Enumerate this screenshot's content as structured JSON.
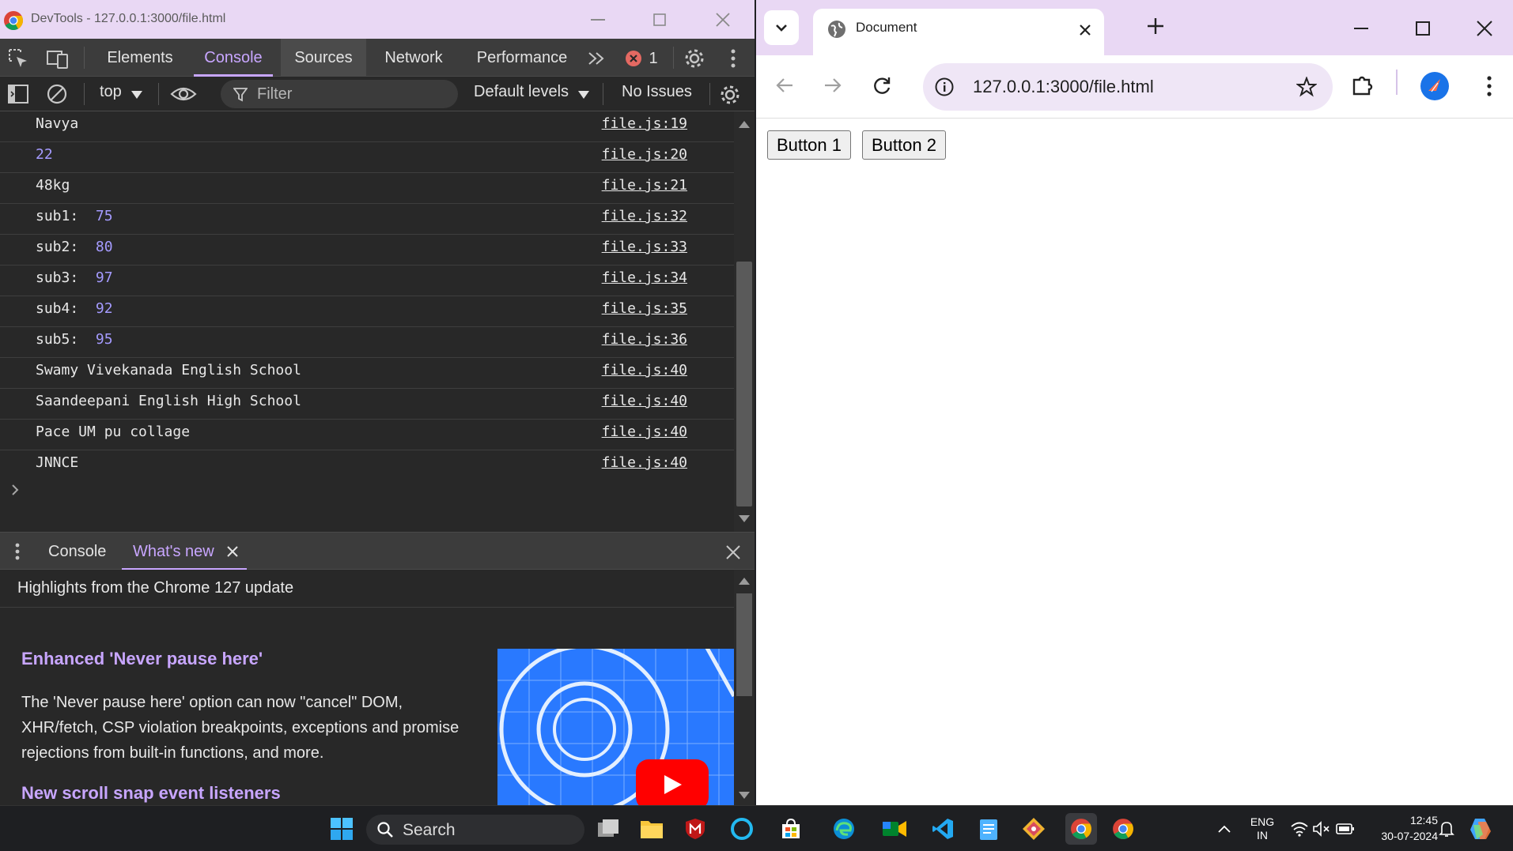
{
  "devtools": {
    "window_title": "DevTools - 127.0.0.1:3000/file.html",
    "tabs": [
      "Elements",
      "Console",
      "Sources",
      "Network",
      "Performance"
    ],
    "error_count": "1",
    "toolbar": {
      "context": "top",
      "filter_placeholder": "Filter",
      "levels": "Default levels",
      "issues": "No Issues"
    },
    "console_rows": [
      {
        "text": "Navya",
        "num": "",
        "src": "file.js:19"
      },
      {
        "text": "",
        "num": "22",
        "src": "file.js:20"
      },
      {
        "text": "48kg",
        "num": "",
        "src": "file.js:21"
      },
      {
        "text": "sub1:  ",
        "num": "75",
        "src": "file.js:32"
      },
      {
        "text": "sub2:  ",
        "num": "80",
        "src": "file.js:33"
      },
      {
        "text": "sub3:  ",
        "num": "97",
        "src": "file.js:34"
      },
      {
        "text": "sub4:  ",
        "num": "92",
        "src": "file.js:35"
      },
      {
        "text": "sub5:  ",
        "num": "95",
        "src": "file.js:36"
      },
      {
        "text": "Swamy Vivekanada English School",
        "num": "",
        "src": "file.js:40"
      },
      {
        "text": "Saandeepani English High School",
        "num": "",
        "src": "file.js:40"
      },
      {
        "text": "Pace UM pu collage",
        "num": "",
        "src": "file.js:40"
      },
      {
        "text": "JNNCE",
        "num": "",
        "src": "file.js:40"
      }
    ],
    "drawer": {
      "tab_console": "Console",
      "tab_whatsnew": "What's new",
      "heading": "Highlights from the Chrome 127 update",
      "item1_title": "Enhanced 'Never pause here'",
      "item1_body": "The 'Never pause here' option can now \"cancel\" DOM, XHR/fetch, CSP violation breakpoints, exceptions and promise rejections from built-in functions, and more.",
      "item2_title": "New scroll snap event listeners"
    }
  },
  "browser": {
    "tab_title": "Document",
    "url_host": "127.0.0.1",
    "url_rest": ":3000/file.html",
    "page_buttons": [
      "Button 1",
      "Button 2"
    ]
  },
  "taskbar": {
    "search_label": "Search",
    "lang_top": "ENG",
    "lang_bottom": "IN",
    "time": "12:45",
    "date": "30-07-2024"
  },
  "colors": {
    "accent": "#c8a6ff",
    "titlebar": "#e9d8f4",
    "console_number": "#a59bff",
    "error": "#e46962"
  }
}
